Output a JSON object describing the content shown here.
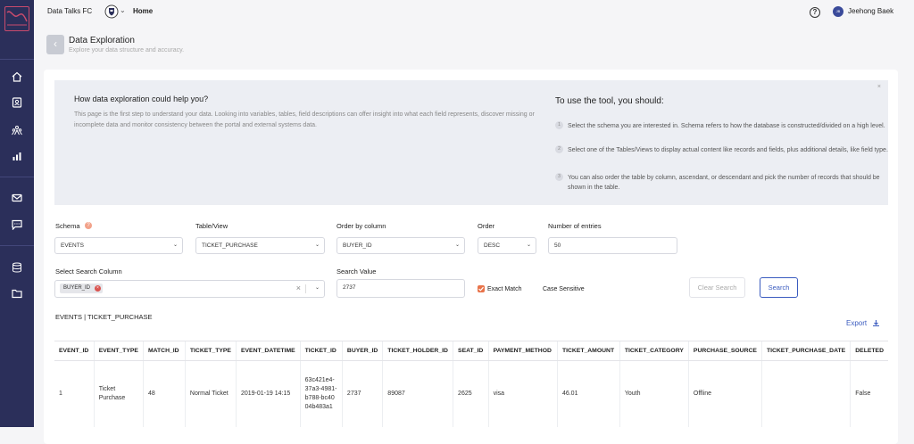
{
  "topbar": {
    "org": "Data Talks FC",
    "chevron": "⌄",
    "home": "Home",
    "help": "?",
    "avatar": "JB",
    "user": "Jeehong Baek"
  },
  "page": {
    "title": "Data Exploration",
    "subtitle": "Explore your data structure and accuracy.",
    "back": "‹"
  },
  "info": {
    "title": "How data exploration could help you?",
    "text": "This page is the first step to understand your data. Looking into variables, tables, field descriptions can offer insight into what each field represents, discover missing or incomplete data and monitor consistency between the portal and external systems data.",
    "tool_title": "To use the tool, you should:",
    "close": "×",
    "steps": [
      {
        "n": "1",
        "text": "Select the schema you are interested in. Schema refers to how the database is constructed/divided on a high level."
      },
      {
        "n": "2",
        "text": "Select one of the Tables/Views to display actual content like records and fields, plus additional details, like field type."
      },
      {
        "n": "3",
        "text": "You can also order the table by column, ascendant, or descendant and pick the number of records that should be shown in the table."
      }
    ]
  },
  "form": {
    "schema_label": "Schema",
    "schema_value": "EVENTS",
    "table_label": "Table/View",
    "table_value": "TICKET_PURCHASE",
    "order_col_label": "Order by column",
    "order_col_value": "BUYER_ID",
    "order_label": "Order",
    "order_value": "DESC",
    "entries_label": "Number of entries",
    "entries_value": "50",
    "search_col_label": "Select Search Column",
    "search_col_tag": "BUYER_ID",
    "search_val_label": "Search Value",
    "search_val_value": "2737",
    "exact_match": "Exact Match",
    "case_sensitive": "Case Sensitive",
    "clear_search": "Clear Search",
    "search": "Search"
  },
  "results": {
    "table_name": "EVENTS | TICKET_PURCHASE",
    "export": "Export"
  },
  "table": {
    "columns": [
      "EVENT_ID",
      "EVENT_TYPE",
      "MATCH_ID",
      "TICKET_TYPE",
      "EVENT_DATETIME",
      "TICKET_ID",
      "BUYER_ID",
      "TICKET_HOLDER_ID",
      "SEAT_ID",
      "PAYMENT_METHOD",
      "TICKET_AMOUNT",
      "TICKET_CATEGORY",
      "PURCHASE_SOURCE",
      "TICKET_PURCHASE_DATE",
      "DELETED"
    ],
    "rows": [
      [
        "1",
        "Ticket Purchase",
        "48",
        "Normal Ticket",
        "2019-01-19 14:15",
        "63c421e4-37a3-4981-b788-bc4004b483a1",
        "2737",
        "89087",
        "2625",
        "visa",
        "46.01",
        "Youth",
        "Offline",
        "",
        "False"
      ]
    ]
  },
  "colors": {
    "sidebar": "#2b2f5a",
    "accent": "#3a5bbf",
    "danger": "#d9534f",
    "checkbox": "#e8734a"
  }
}
